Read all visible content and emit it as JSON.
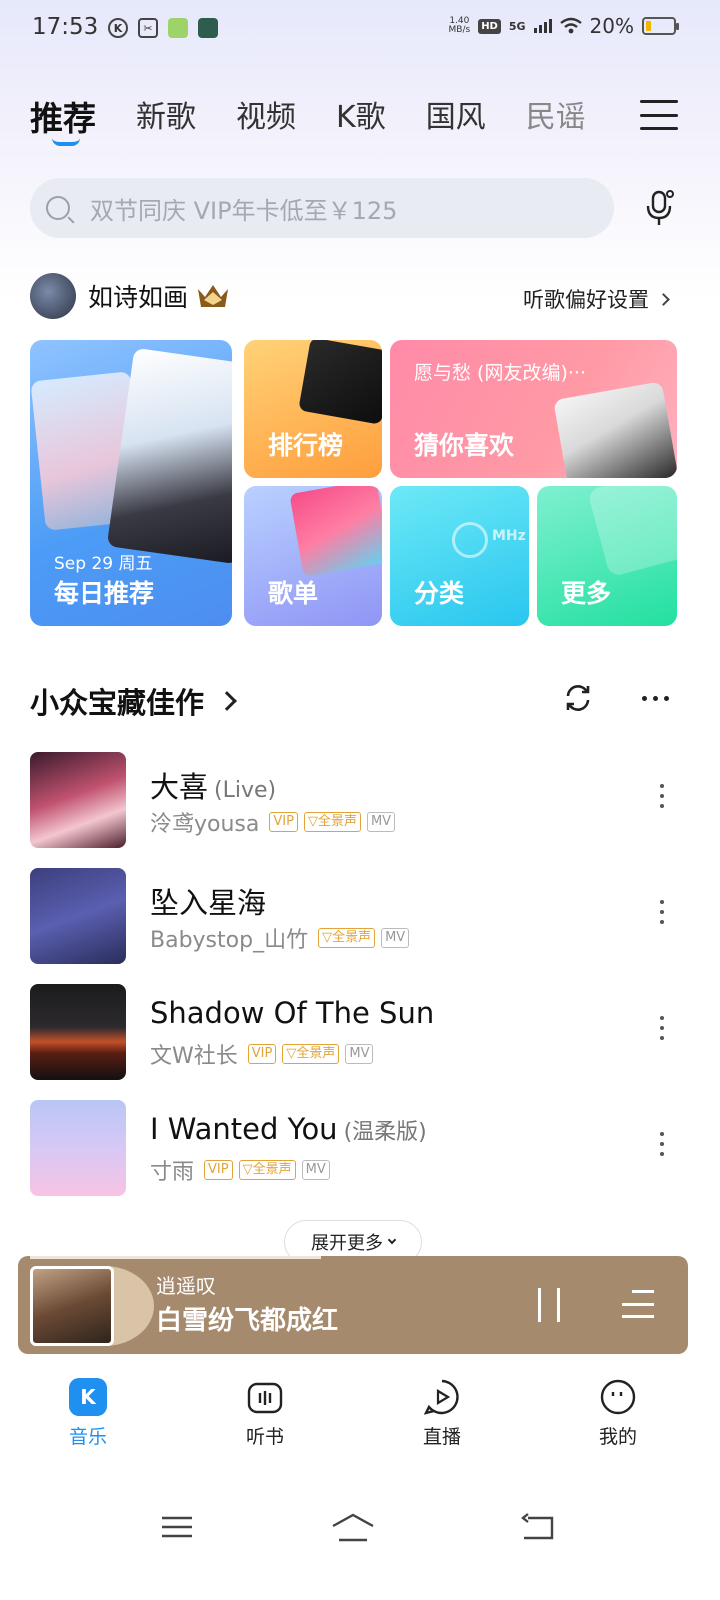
{
  "status_bar": {
    "time": "17:53",
    "speed_value": "1.40",
    "speed_unit": "MB/s",
    "hd": "HD",
    "network": "5G",
    "battery": "20%",
    "battery_level": 0.2
  },
  "tabs": [
    "推荐",
    "新歌",
    "视频",
    "K歌",
    "国风",
    "民谣"
  ],
  "search": {
    "placeholder": "双节同庆 VIP年卡低至￥125"
  },
  "user": {
    "name": "如诗如画",
    "pref_label": "听歌偏好设置"
  },
  "cards": {
    "daily": {
      "date": "Sep 29 周五",
      "label": "每日推荐"
    },
    "rank": {
      "label": "排行榜"
    },
    "guess": {
      "subtitle": "愿与愁 (网友改编)···",
      "label": "猜你喜欢"
    },
    "playlist": {
      "label": "歌单"
    },
    "category": {
      "label": "分类",
      "deco_text": "MHz"
    },
    "more": {
      "label": "更多"
    }
  },
  "section": {
    "title": "小众宝藏佳作"
  },
  "songs": [
    {
      "title": "大喜",
      "suffix": "(Live)",
      "artist": "泠鸢yousa",
      "vip": "VIP",
      "quality": "全景声",
      "mv": "MV"
    },
    {
      "title": "坠入星海",
      "suffix": "",
      "artist": "Babystop_山竹",
      "vip": "",
      "quality": "全景声",
      "mv": "MV"
    },
    {
      "title": "Shadow Of The Sun",
      "suffix": "",
      "artist": "文W社长",
      "vip": "VIP",
      "quality": "全景声",
      "mv": "MV"
    },
    {
      "title": "I Wanted You",
      "suffix": "(温柔版)",
      "artist": "寸雨",
      "vip": "VIP",
      "quality": "全景声",
      "mv": "MV"
    }
  ],
  "expand_label": "展开更多",
  "player": {
    "artist": "逍遥叹",
    "song": "白雪纷飞都成红",
    "progress": 0.45
  },
  "bottom_nav": [
    {
      "label": "音乐",
      "icon": "K"
    },
    {
      "label": "听书"
    },
    {
      "label": "直播"
    },
    {
      "label": "我的"
    }
  ],
  "colors": {
    "accent": "#1f8ff0",
    "player_bg": "#a58a6d",
    "badge_gold": "#e2a339"
  }
}
